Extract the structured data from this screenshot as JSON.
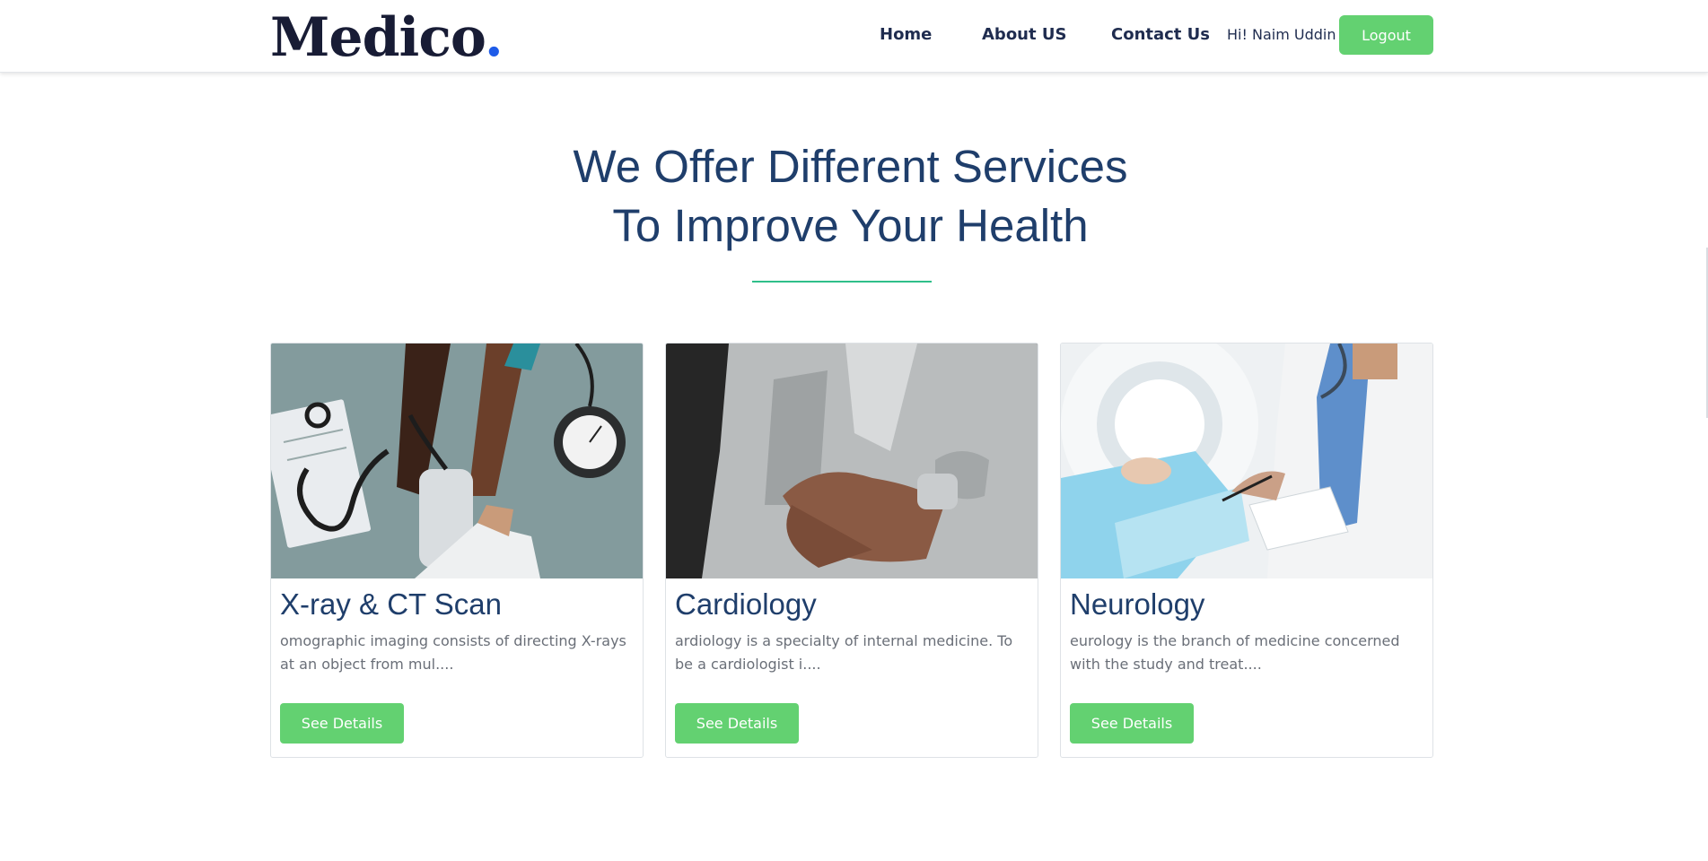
{
  "header": {
    "brand": "Medico",
    "brand_dot": ".",
    "nav": {
      "home": "Home",
      "about": "About US",
      "contact": "Contact Us"
    },
    "greeting": "Hi! Naim Uddin",
    "logout_label": "Logout"
  },
  "services": {
    "title_line1": "We Offer Different Services",
    "title_line2": "To Improve Your Health",
    "cards": [
      {
        "title": "X-ray & CT Scan",
        "description": "omographic imaging consists of directing X-rays at an object from mul....",
        "button": "See Details",
        "image_icon": "blood-pressure-image"
      },
      {
        "title": "Cardiology",
        "description": "ardiology is a specialty of internal medicine. To be a cardiologist i....",
        "button": "See Details",
        "image_icon": "chest-pain-image"
      },
      {
        "title": "Neurology",
        "description": "eurology is the branch of medicine concerned with the study and treat....",
        "button": "See Details",
        "image_icon": "mri-scan-image"
      }
    ]
  },
  "colors": {
    "brand_text": "#181c35",
    "brand_dot": "#1e5be8",
    "heading": "#1f3e6b",
    "accent_green": "#63d171",
    "divider": "#2fbf8a"
  }
}
